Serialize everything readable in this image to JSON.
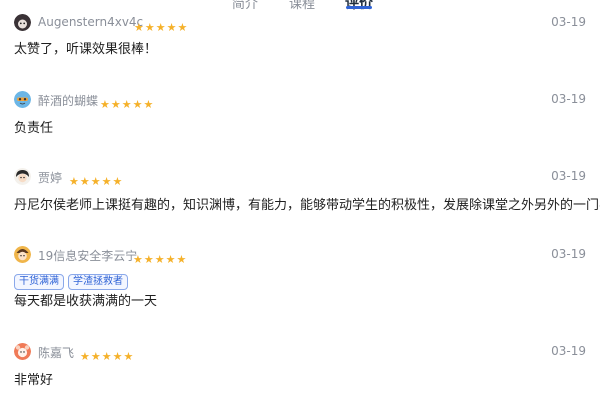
{
  "tabs": [
    {
      "label": "简介",
      "active": false
    },
    {
      "label": "课程",
      "active": false
    },
    {
      "label": "评价",
      "active": true
    }
  ],
  "colors": {
    "accent": "#2f63d6",
    "star": "#f5b12a",
    "muted_text": "#8a8f99",
    "tag_border": "#8aa8ea"
  },
  "reviews": [
    {
      "username": "Augenstern4xv4c",
      "avatar_icon": "dark-cat-avatar",
      "rating": 5,
      "date": "03-19",
      "tags": [],
      "text": "太赞了，听课效果很棒！"
    },
    {
      "username": "醉酒的蝴蝶",
      "avatar_icon": "blue-mascot-avatar",
      "rating": 5,
      "date": "03-19",
      "tags": [],
      "text": "负责任"
    },
    {
      "username": "贾婷",
      "avatar_icon": "cartoon-girl-avatar",
      "rating": 5,
      "date": "03-19",
      "tags": [],
      "text": "丹尼尔侯老师上课挺有趣的，知识渊博，有能力，能够带动学生的积极性，发展除课堂之外另外的一门学科"
    },
    {
      "username": "19信息安全李云宁",
      "avatar_icon": "orange-face-avatar",
      "rating": 5,
      "date": "03-19",
      "tags": [
        "干货满满",
        "学渣拯救者"
      ],
      "text": "每天都是收获满满的一天"
    },
    {
      "username": "陈嘉飞",
      "avatar_icon": "bear-avatar",
      "rating": 5,
      "date": "03-19",
      "tags": [],
      "text": "非常好"
    }
  ]
}
